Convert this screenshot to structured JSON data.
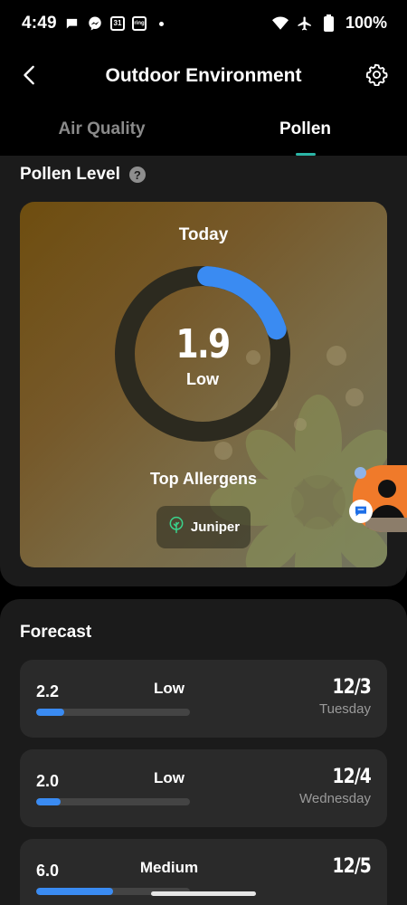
{
  "status_bar": {
    "time": "4:49",
    "calendar_day": "31",
    "ring_label": "ring",
    "battery": "100%",
    "icons": [
      "chat-bubble-icon",
      "messenger-icon",
      "calendar-icon",
      "ring-icon",
      "wifi-icon",
      "airplane-icon",
      "battery-icon"
    ]
  },
  "header": {
    "title": "Outdoor Environment",
    "back_icon": "back-arrow-icon",
    "settings_icon": "gear-icon"
  },
  "tabs": [
    {
      "label": "Air Quality",
      "active": false
    },
    {
      "label": "Pollen",
      "active": true
    }
  ],
  "pollen": {
    "section_title": "Pollen Level",
    "today_label": "Today",
    "value": "1.9",
    "level": "Low",
    "gauge_fraction": 0.19,
    "allergens_title": "Top Allergens",
    "allergens": [
      {
        "name": "Juniper",
        "icon": "tree-icon"
      }
    ]
  },
  "forecast": {
    "title": "Forecast",
    "items": [
      {
        "value": "2.2",
        "level": "Low",
        "date": "12/3",
        "day": "Tuesday",
        "fraction": 0.18
      },
      {
        "value": "2.0",
        "level": "Low",
        "date": "12/4",
        "day": "Wednesday",
        "fraction": 0.16
      },
      {
        "value": "6.0",
        "level": "Medium",
        "date": "12/5",
        "day": "",
        "fraction": 0.5
      }
    ]
  },
  "colors": {
    "accent_tab": "#2bb5a6",
    "gauge_fill": "#3a8bf2",
    "card_bg": "#2a2a2a",
    "allergen_icon": "#3ad38c"
  }
}
